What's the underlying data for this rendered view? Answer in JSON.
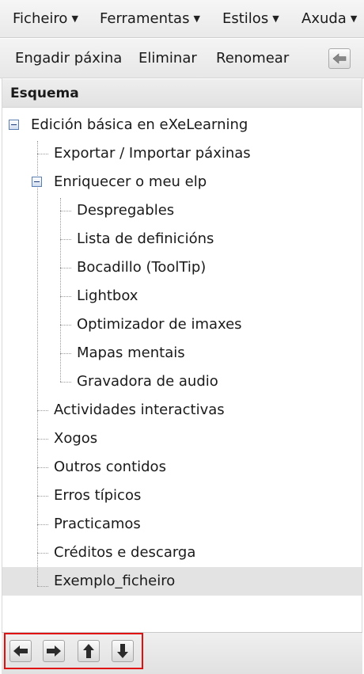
{
  "menubar": {
    "items": [
      {
        "label": "Ficheiro"
      },
      {
        "label": "Ferramentas"
      },
      {
        "label": "Estilos"
      },
      {
        "label": "Axuda"
      }
    ]
  },
  "toolbar": {
    "add_page": "Engadir páxina",
    "delete": "Eliminar",
    "rename": "Renomear",
    "collapse_icon": "arrow-left-icon"
  },
  "outline": {
    "header": "Esquema",
    "root": "Edición básica en eXeLearning",
    "nodes": [
      {
        "label": "Exportar / Importar páxinas"
      },
      {
        "label": "Enriquecer o meu elp",
        "expanded": true
      },
      {
        "label": "Despregables"
      },
      {
        "label": "Lista de definicións"
      },
      {
        "label": "Bocadillo (ToolTip)"
      },
      {
        "label": "Lightbox"
      },
      {
        "label": "Optimizador de imaxes"
      },
      {
        "label": "Mapas mentais"
      },
      {
        "label": "Gravadora de audio"
      },
      {
        "label": "Actividades interactivas"
      },
      {
        "label": "Xogos"
      },
      {
        "label": "Outros contidos"
      },
      {
        "label": "Erros típicos"
      },
      {
        "label": "Practicamos"
      },
      {
        "label": "Créditos e descarga"
      },
      {
        "label": "Exemplo_ficheiro",
        "selected": true
      }
    ]
  },
  "navigation": {
    "buttons": [
      "arrow-left-icon",
      "arrow-right-icon",
      "arrow-up-icon",
      "arrow-down-icon"
    ],
    "highlight_color": "#e01010"
  },
  "colors": {
    "selected_row": "#e3e3e3",
    "toggle_border": "#5b7db0"
  }
}
